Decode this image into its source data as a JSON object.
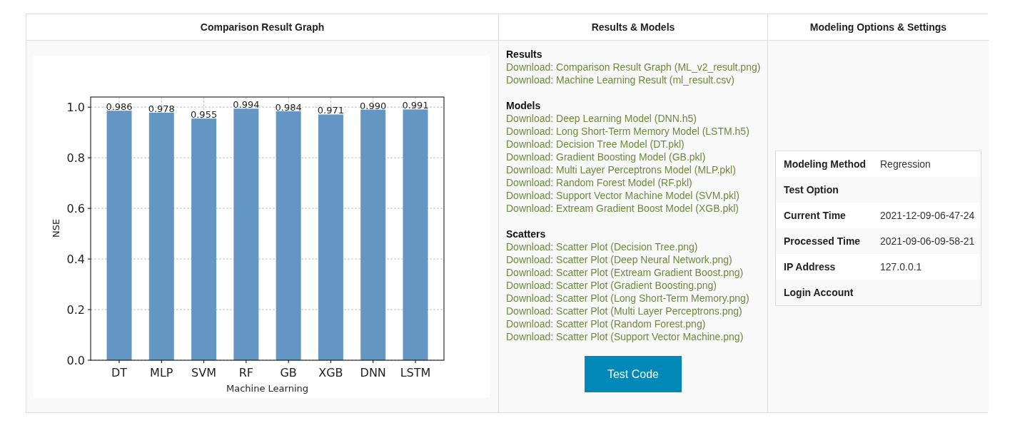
{
  "columns": [
    {
      "title": "Comparison Result Graph"
    },
    {
      "title": "Results & Models"
    },
    {
      "title": "Modeling Options & Settings"
    }
  ],
  "graph": {
    "chart_data": {
      "type": "bar",
      "xlabel": "Machine Learning",
      "ylabel": "NSE",
      "categories": [
        "DT",
        "MLP",
        "SVM",
        "RF",
        "GB",
        "XGB",
        "DNN",
        "LSTM"
      ],
      "grid": true,
      "series": [
        {
          "color": "#6396c2",
          "values": [
            0.986,
            0.978,
            0.955,
            0.994,
            0.984,
            0.971,
            0.99,
            0.991
          ]
        }
      ],
      "ylim": [
        0,
        1.04
      ],
      "yticks": [
        {
          "value": 0,
          "label": "0.0"
        },
        {
          "value": 0.2,
          "label": "0.2"
        },
        {
          "value": 0.4,
          "label": "0.4"
        },
        {
          "value": 0.6,
          "label": "0.6"
        },
        {
          "value": 0.8,
          "label": "0.8"
        },
        {
          "value": 1,
          "label": "1.0"
        }
      ],
      "value_labels": [
        "0.986",
        "0.978",
        "0.955",
        "0.994",
        "0.984",
        "0.971",
        "0.990",
        "0.991"
      ]
    }
  },
  "sections": [
    {
      "title": "Results",
      "links": [
        "Download: Comparison Result Graph (ML_v2_result.png)",
        "Download: Machine Learning Result (ml_result.csv)"
      ]
    },
    {
      "title": "Models",
      "links": [
        "Download: Deep Learning Model (DNN.h5)",
        "Download: Long Short-Term Memory Model (LSTM.h5)",
        "Download: Decision Tree Model (DT.pkl)",
        "Download: Gradient Boosting Model (GB.pkl)",
        "Download: Multi Layer Perceptrons Model (MLP.pkl)",
        "Download: Random Forest Model (RF.pkl)",
        "Download: Support Vector Machine Model (SVM.pkl)",
        "Download: Extream Gradient Boost Model (XGB.pkl)"
      ]
    },
    {
      "title": "Scatters",
      "links": [
        "Download: Scatter Plot (Decision Tree.png)",
        "Download: Scatter Plot (Deep Neural Network.png)",
        "Download: Scatter Plot (Extream Gradient Boost.png)",
        "Download: Scatter Plot (Gradient Boosting.png)",
        "Download: Scatter Plot (Long Short-Term Memory.png)",
        "Download: Scatter Plot (Multi Layer Perceptrons.png)",
        "Download: Scatter Plot (Random Forest.png)",
        "Download: Scatter Plot (Support Vector Machine.png)"
      ]
    }
  ],
  "button": "Test Code",
  "settings": [
    {
      "label": "Modeling Method",
      "value": "Regression"
    },
    {
      "label": "Test Option"
    },
    {
      "label": "Current Time",
      "value": "2021-12-09-06-47-24"
    },
    {
      "label": "Processed Time",
      "value": "2021-09-06-09-58-21"
    },
    {
      "label": "IP Address",
      "value": "127.0.0.1"
    },
    {
      "label": "Login Account"
    }
  ]
}
